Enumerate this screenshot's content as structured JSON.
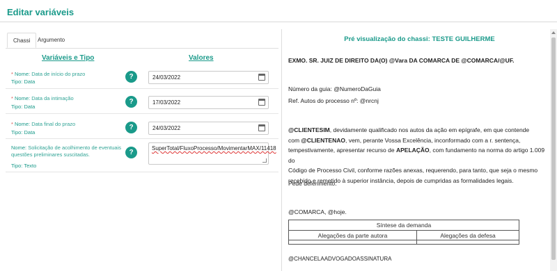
{
  "page_title": "Editar variáveis",
  "tabs": [
    {
      "label": "Chassi",
      "active": true
    },
    {
      "label": "Argumento",
      "active": false
    }
  ],
  "columns": {
    "variables": "Variáveis e Tipo",
    "values": "Valores"
  },
  "fields": [
    {
      "required_mark": "*",
      "name_key": "Nome:",
      "name": "Data de início do prazo",
      "type_key": "Tipo:",
      "type": "Data",
      "value": "24/03/2022",
      "control": "date"
    },
    {
      "required_mark": "*",
      "name_key": "Nome:",
      "name": "Data da intimação",
      "type_key": "Tipo:",
      "type": "Data",
      "value": "17/03/2022",
      "control": "date"
    },
    {
      "required_mark": "*",
      "name_key": "Nome:",
      "name": "Data final do prazo",
      "type_key": "Tipo:",
      "type": "Data",
      "value": "24/03/2022",
      "control": "date"
    },
    {
      "required_mark": "",
      "name_key": "Nome:",
      "name": "Solicitação de acolhimento de eventuais questões preliminares suscitadas.",
      "type_key": "Tipo:",
      "type": "Texto",
      "value": "SuperTotal/FluxoProcesso/MovimentarMAX/11418",
      "control": "textarea"
    }
  ],
  "help_icon_glyph": "?",
  "preview": {
    "title": "Pré visualização do chassi: TESTE GUILHERME",
    "header_line": "EXMO. SR. JUIZ DE DIREITO DA(O) @Vara DA COMARCA DE @COMARCA/@UF.",
    "guide_number": "Número da guia: @NumeroDaGuia",
    "process_ref": "Ref. Autos do processo nº: @nrcnj",
    "paragraph_lines": [
      {
        "bold": "@CLIENTESIM",
        "text": ", devidamente qualificado nos autos da ação em epígrafe, em que contende"
      },
      {
        "pre": "com ",
        "bold": "@CLIENTENAO",
        "text": ", vem, perante Vossa Excelência, inconformado com a r. sentença,"
      },
      {
        "pre": "tempestivamente, apresentar recurso de ",
        "bold": "APELAÇÃO",
        "text": ", com fundamento na norma do artigo 1.009 do"
      },
      {
        "text": "Código de Processo Civil, conforme razões anexas, requerendo, para tanto, que seja o mesmo"
      },
      {
        "text": "recebido e remetido à superior instância, depois de cumpridas as formalidades legais."
      }
    ],
    "closing": "Pede deferimento.",
    "place_date": "@COMARCA, @hoje.",
    "synthesis_table": {
      "title": "Síntese da demanda",
      "headers": [
        "Alegações da parte autora",
        "Alegações da defesa"
      ]
    },
    "signature": "@CHANCELAADVOGADOASSINATURA"
  },
  "colors": {
    "accent": "#1a9a8a",
    "required": "#d9534f"
  },
  "icons": [
    "help-icon",
    "calendar-icon",
    "resize-handle-icon"
  ]
}
